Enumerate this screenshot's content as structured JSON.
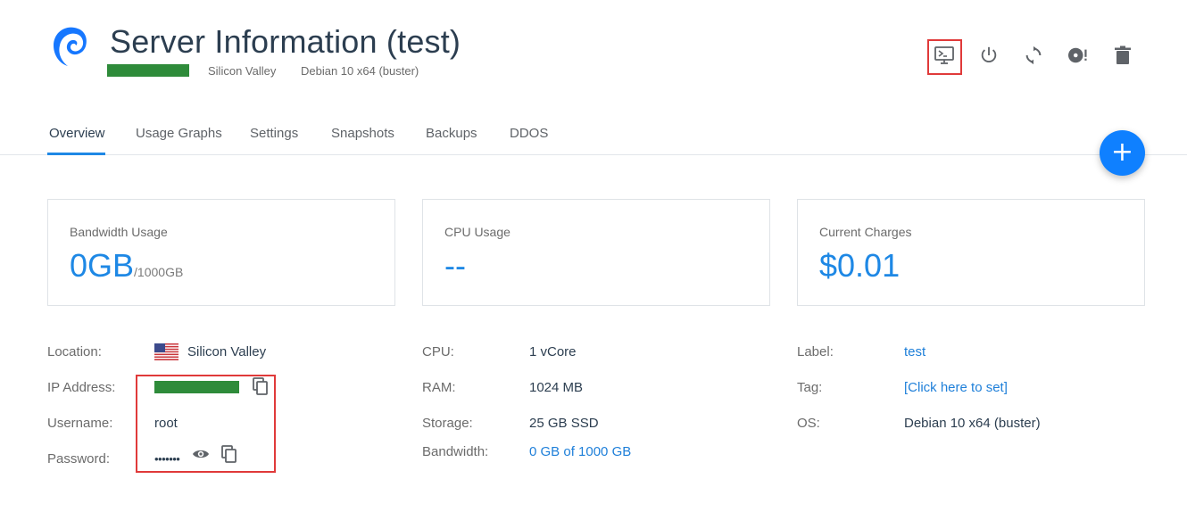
{
  "header": {
    "title": "Server Information (test)",
    "location": "Silicon Valley",
    "os": "Debian 10 x64 (buster)",
    "status_color": "#2e8b3a"
  },
  "toolbar": {
    "icons": [
      "console-icon",
      "power-icon",
      "restart-icon",
      "reinstall-icon",
      "trash-icon"
    ],
    "highlight_color": "#e03a3a"
  },
  "tabs": [
    {
      "label": "Overview",
      "active": true
    },
    {
      "label": "Usage Graphs"
    },
    {
      "label": "Settings"
    },
    {
      "label": "Snapshots"
    },
    {
      "label": "Backups"
    },
    {
      "label": "DDOS"
    }
  ],
  "fab": {
    "icon": "plus-icon",
    "color": "#0f80ff"
  },
  "cards": {
    "bandwidth": {
      "label": "Bandwidth Usage",
      "value": "0GB",
      "suffix": "/1000GB"
    },
    "cpu": {
      "label": "CPU Usage",
      "value": "--"
    },
    "charges": {
      "label": "Current Charges",
      "value": "$0.01"
    }
  },
  "details": {
    "location_label": "Location:",
    "location_value": "Silicon Valley",
    "ip_label": "IP Address:",
    "username_label": "Username:",
    "username_value": "root",
    "password_label": "Password:",
    "password_value": "•••••••",
    "cpu_label": "CPU:",
    "cpu_value": "1 vCore",
    "ram_label": "RAM:",
    "ram_value": "1024 MB",
    "storage_label": "Storage:",
    "storage_value": "25 GB SSD",
    "bandwidth_label": "Bandwidth:",
    "bandwidth_value": "0 GB of 1000 GB",
    "label_label": "Label:",
    "label_value": "test",
    "tag_label": "Tag:",
    "tag_value": "[Click here to set]",
    "os_label": "OS:",
    "os_value": "Debian 10 x64 (buster)"
  },
  "colors": {
    "accent": "#1e88e5",
    "link": "#1e7fd9"
  }
}
